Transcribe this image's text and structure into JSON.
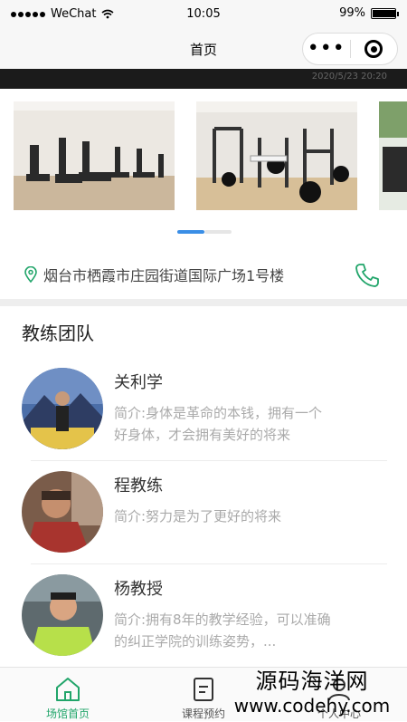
{
  "status_bar": {
    "carrier": "WeChat",
    "time": "10:05",
    "battery": "99%",
    "battery_level": 0.99
  },
  "nav": {
    "title": "首页",
    "more_icon": "more-dots-icon",
    "close_icon": "target-icon"
  },
  "banner": {
    "date_text": "2020/5/23 20:20"
  },
  "gallery": {
    "active_index": 0,
    "count": 2
  },
  "location": {
    "address": "烟台市栖霞市庄园街道国际广场1号楼",
    "icon": "location-pin-icon",
    "call_icon": "phone-icon"
  },
  "coaches_section": {
    "title": "教练团队",
    "coaches": [
      {
        "name": "关利学",
        "intro": "简介:身体是革命的本钱，拥有一个好身体，才会拥有美好的将来"
      },
      {
        "name": "程教练",
        "intro": "简介:努力是为了更好的将来"
      },
      {
        "name": "杨教授",
        "intro": "简介:拥有8年的教学经验，可以准确的纠正学院的训练姿势，..."
      }
    ]
  },
  "tabs": [
    {
      "label": "场馆首页",
      "icon": "home-icon",
      "active": true
    },
    {
      "label": "课程预约",
      "icon": "schedule-icon",
      "active": false
    },
    {
      "label": "个人中心",
      "icon": "user-icon",
      "active": false
    }
  ],
  "colors": {
    "accent": "#21a56a",
    "indicator_active": "#3a8ee6",
    "indicator_inactive": "#e6e6e6"
  },
  "watermark": {
    "line1": "源码海洋网",
    "line2": "www.codehy.com"
  }
}
